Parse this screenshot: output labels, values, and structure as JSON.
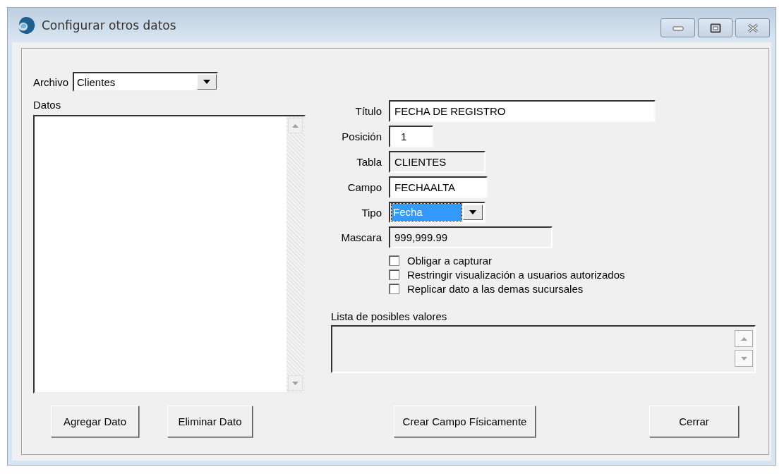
{
  "window": {
    "title": "Configurar otros datos"
  },
  "archivo": {
    "label": "Archivo",
    "value": "Clientes"
  },
  "datos": {
    "label": "Datos"
  },
  "fields": [
    {
      "label": "Título",
      "value": "FECHA DE REGISTRO",
      "kind": "text",
      "focused": false
    },
    {
      "label": "Posición",
      "value": "1",
      "kind": "text",
      "focused": false
    },
    {
      "label": "Tabla",
      "value": "CLIENTES",
      "kind": "readonly",
      "focused": false
    },
    {
      "label": "Campo",
      "value": "FECHAALTA",
      "kind": "text",
      "focused": false
    },
    {
      "label": "Tipo",
      "value": "Fecha",
      "kind": "combo",
      "focused": true
    },
    {
      "label": "Mascara",
      "value": "999,999.99",
      "kind": "readonly",
      "focused": false
    }
  ],
  "checkboxes": [
    {
      "label": "Obligar a capturar",
      "checked": false
    },
    {
      "label": "Restringir visualización a usuarios autorizados",
      "checked": false
    },
    {
      "label": "Replicar dato a las demas sucursales",
      "checked": false
    }
  ],
  "values_list": {
    "label": "Lista de posibles valores"
  },
  "buttons": [
    "Agregar Dato",
    "Eliminar Dato",
    "Crear Campo Físicamente",
    "Cerrar"
  ]
}
